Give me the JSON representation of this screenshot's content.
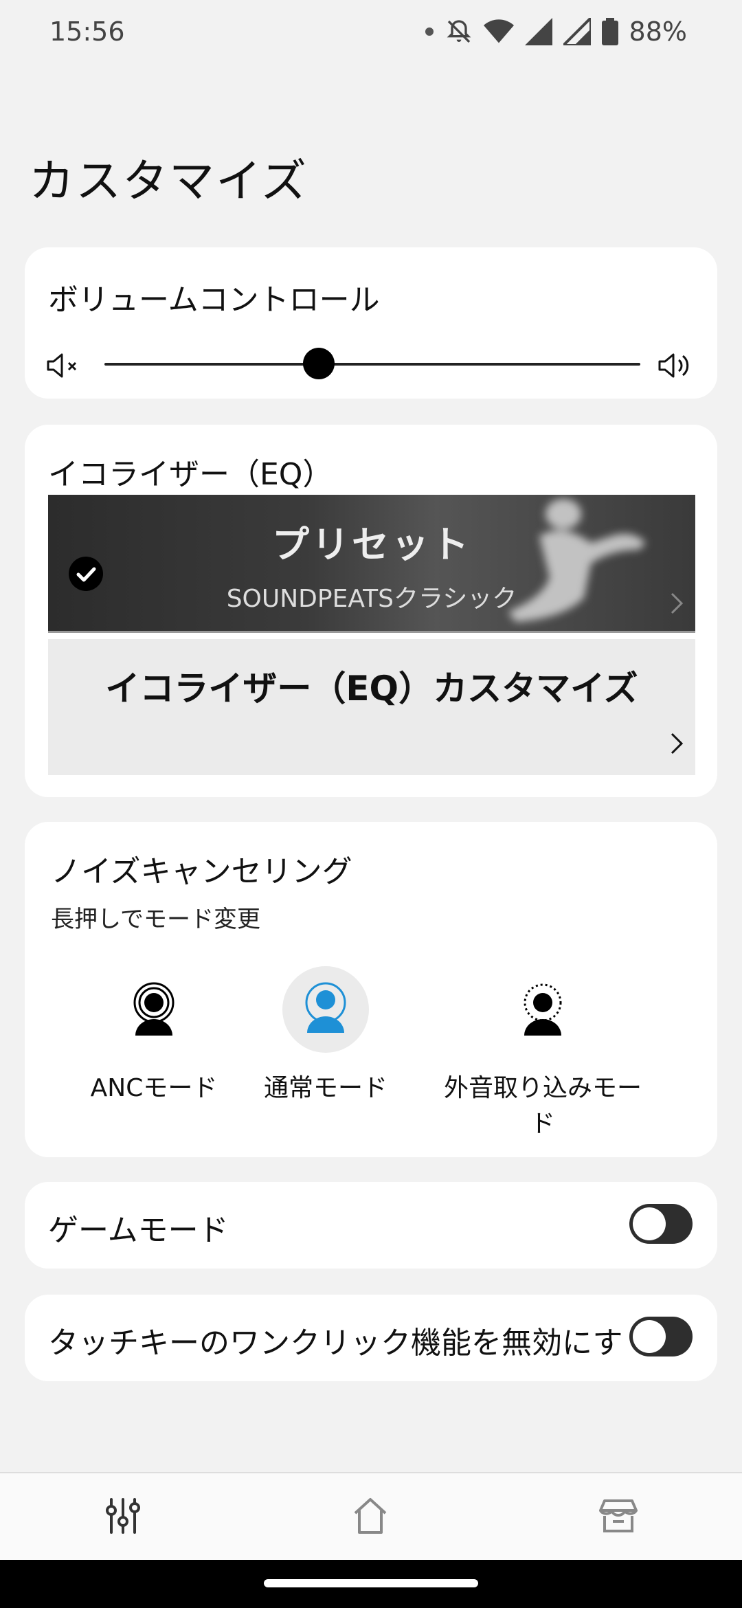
{
  "status_bar": {
    "time": "15:56",
    "battery": "88%"
  },
  "page_title": "カスタマイズ",
  "volume": {
    "title": "ボリュームコントロール",
    "level": 0.4
  },
  "eq": {
    "title": "イコライザー（EQ）",
    "preset_title": "プリセット",
    "preset_value": "SOUNDPEATSクラシック",
    "custom_title": "イコライザー（EQ）カスタマイズ"
  },
  "noise": {
    "title": "ノイズキャンセリング",
    "subtitle": "長押しでモード変更",
    "modes": [
      {
        "label": "ANCモード",
        "icon": "anc-mode-icon",
        "active": false
      },
      {
        "label": "通常モード",
        "icon": "normal-mode-icon",
        "active": true
      },
      {
        "label": "外音取り込みモード",
        "icon": "ambient-mode-icon",
        "active": false
      }
    ],
    "active_color": "#1e90d6"
  },
  "game_mode": {
    "label": "ゲームモード",
    "enabled": false
  },
  "touch_key": {
    "label": "タッチキーのワンクリック機能を無効にす",
    "enabled": false
  },
  "bottom_nav": {
    "items": [
      {
        "icon": "equalizer-sliders-icon"
      },
      {
        "icon": "home-icon"
      },
      {
        "icon": "store-icon"
      }
    ]
  }
}
